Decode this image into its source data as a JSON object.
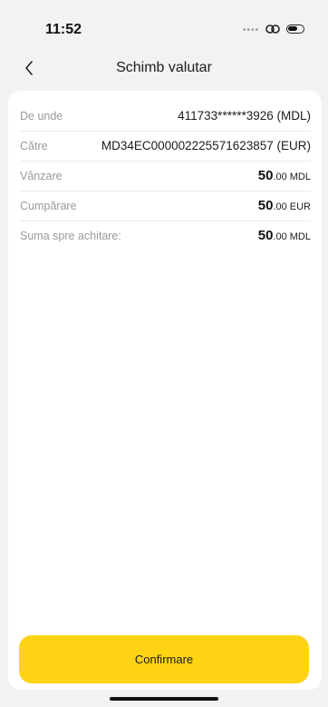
{
  "status_bar": {
    "time": "11:52",
    "signal_icon": "signal-dots-icon",
    "connectivity_icon": "link-icon",
    "battery_icon": "battery-icon"
  },
  "nav": {
    "back_icon": "chevron-left-icon",
    "title": "Schimb valutar"
  },
  "details": [
    {
      "label": "De unde",
      "value": "411733******3926 (MDL)"
    },
    {
      "label": "Către",
      "value": "MD34EC000002225571623857 (EUR)"
    },
    {
      "label": "Vânzare",
      "amount_int": "50",
      "amount_dec": ".00 MDL"
    },
    {
      "label": "Cumpărare",
      "amount_int": "50",
      "amount_dec": ".00 EUR"
    },
    {
      "label": "Suma spre achitare:",
      "amount_int": "50",
      "amount_dec": ".00 MDL"
    }
  ],
  "confirm_label": "Confirmare",
  "colors": {
    "accent": "#fdd314",
    "background": "#f2f2f4",
    "card": "#ffffff"
  }
}
